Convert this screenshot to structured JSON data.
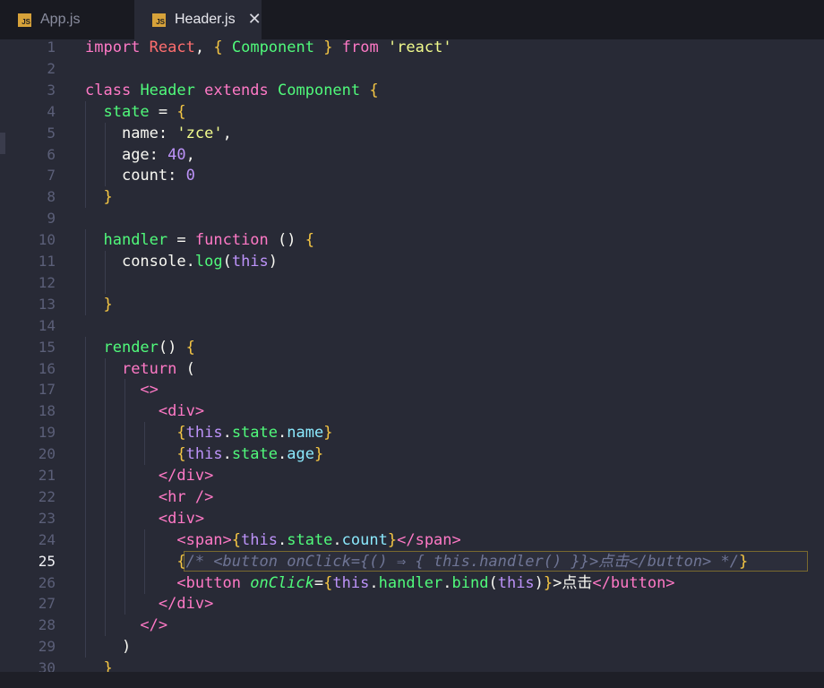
{
  "tabs": [
    {
      "label": "App.js",
      "badge": "JS",
      "active": false
    },
    {
      "label": "Header.js",
      "badge": "JS",
      "active": true,
      "close": "✕"
    }
  ],
  "editor": {
    "current_line": "25",
    "lines": [
      {
        "num": "1",
        "text": "import React, { Component } from 'react'"
      },
      {
        "num": "2",
        "text": ""
      },
      {
        "num": "3",
        "text": "class Header extends Component {"
      },
      {
        "num": "4",
        "text": "  state = {"
      },
      {
        "num": "5",
        "text": "    name: 'zce',"
      },
      {
        "num": "6",
        "text": "    age: 40,"
      },
      {
        "num": "7",
        "text": "    count: 0"
      },
      {
        "num": "8",
        "text": "  }"
      },
      {
        "num": "9",
        "text": ""
      },
      {
        "num": "10",
        "text": "  handler = function () {"
      },
      {
        "num": "11",
        "text": "    console.log(this)"
      },
      {
        "num": "12",
        "text": ""
      },
      {
        "num": "13",
        "text": "  }"
      },
      {
        "num": "14",
        "text": ""
      },
      {
        "num": "15",
        "text": "  render() {"
      },
      {
        "num": "16",
        "text": "    return ("
      },
      {
        "num": "17",
        "text": "      <>"
      },
      {
        "num": "18",
        "text": "        <div>"
      },
      {
        "num": "19",
        "text": "          {this.state.name}"
      },
      {
        "num": "20",
        "text": "          {this.state.age}"
      },
      {
        "num": "21",
        "text": "        </div>"
      },
      {
        "num": "22",
        "text": "        <hr />"
      },
      {
        "num": "23",
        "text": "        <div>"
      },
      {
        "num": "24",
        "text": "          <span>{this.state.count}</span>"
      },
      {
        "num": "25",
        "text": "          {/* <button onClick={() ⇒ { this.handler() }}>点击</button> */}"
      },
      {
        "num": "26",
        "text": "          <button onClick={this.handler.bind(this)}>点击</button>"
      },
      {
        "num": "27",
        "text": "        </div>"
      },
      {
        "num": "28",
        "text": "      </>"
      },
      {
        "num": "29",
        "text": "    )"
      },
      {
        "num": "30",
        "text": "  }"
      }
    ]
  },
  "colors": {
    "keyword": "#ff79c6",
    "string": "#f1fa8c",
    "class_name": "#50fa7b",
    "property": "#8be9fd",
    "number": "#bd93f9",
    "brace": "#f6c744",
    "comment": "#6f7595",
    "background": "#282a36"
  }
}
